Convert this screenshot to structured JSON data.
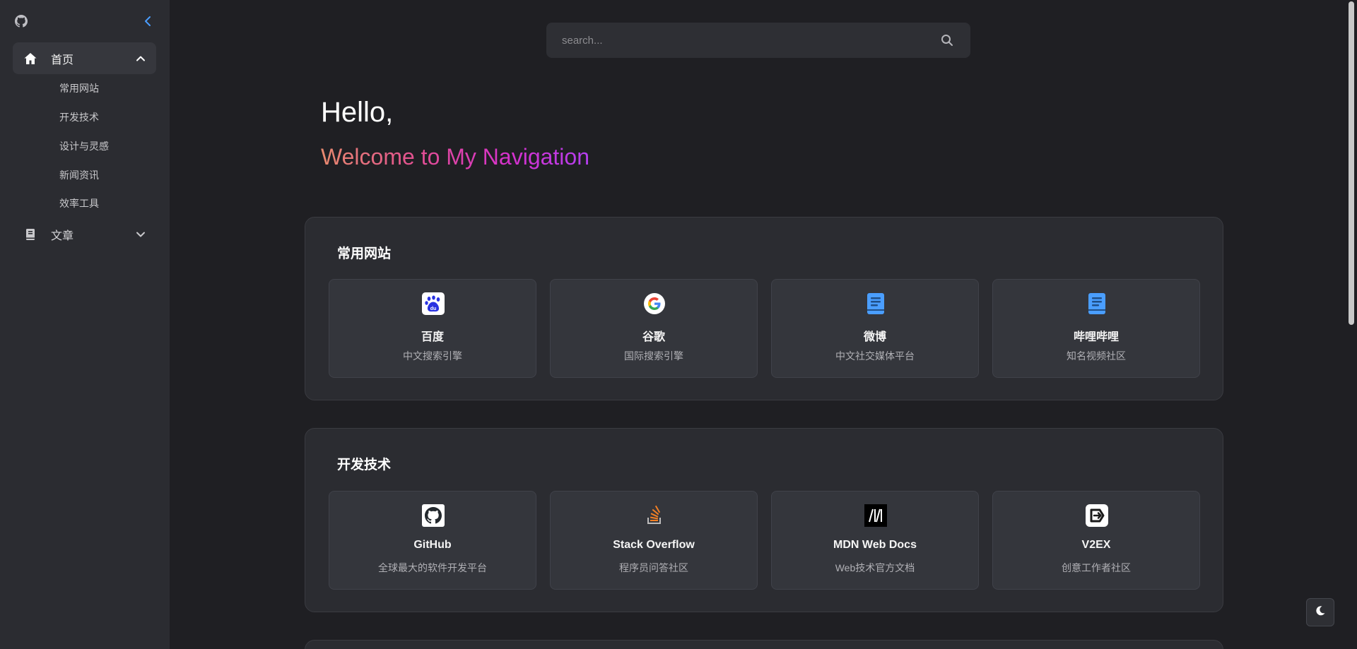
{
  "sidebar": {
    "menu": [
      {
        "label": "首页",
        "icon": "home-icon",
        "expanded": true,
        "children": [
          "常用网站",
          "开发技术",
          "设计与灵感",
          "新闻资讯",
          "效率工具"
        ]
      },
      {
        "label": "文章",
        "icon": "book-icon",
        "expanded": false
      }
    ]
  },
  "search": {
    "placeholder": "search..."
  },
  "hero": {
    "greeting": "Hello,",
    "welcome": "Welcome to My Navigation"
  },
  "sections": [
    {
      "title": "常用网站",
      "cards": [
        {
          "name": "百度",
          "desc": "中文搜索引擎",
          "icon": "baidu-icon"
        },
        {
          "name": "谷歌",
          "desc": "国际搜索引擎",
          "icon": "google-icon"
        },
        {
          "name": "微博",
          "desc": "中文社交媒体平台",
          "icon": "book-icon"
        },
        {
          "name": "哔哩哔哩",
          "desc": "知名视频社区",
          "icon": "book-icon"
        }
      ]
    },
    {
      "title": "开发技术",
      "cards": [
        {
          "name": "GitHub",
          "desc": "全球最大的软件开发平台",
          "icon": "github-icon"
        },
        {
          "name": "Stack Overflow",
          "desc": "程序员问答社区",
          "icon": "stackoverflow-icon"
        },
        {
          "name": "MDN Web Docs",
          "desc": "Web技术官方文档",
          "icon": "mdn-icon"
        },
        {
          "name": "V2EX",
          "desc": "创意工作者社区",
          "icon": "v2ex-icon"
        }
      ]
    }
  ],
  "colors": {
    "background": "#1f1f23",
    "sidebar": "#2b2c31",
    "card": "#34363c",
    "accent_blue": "#4a9eff",
    "gradient": [
      "#e98a6f",
      "#e25090",
      "#d631cd",
      "#b43ff0"
    ]
  }
}
